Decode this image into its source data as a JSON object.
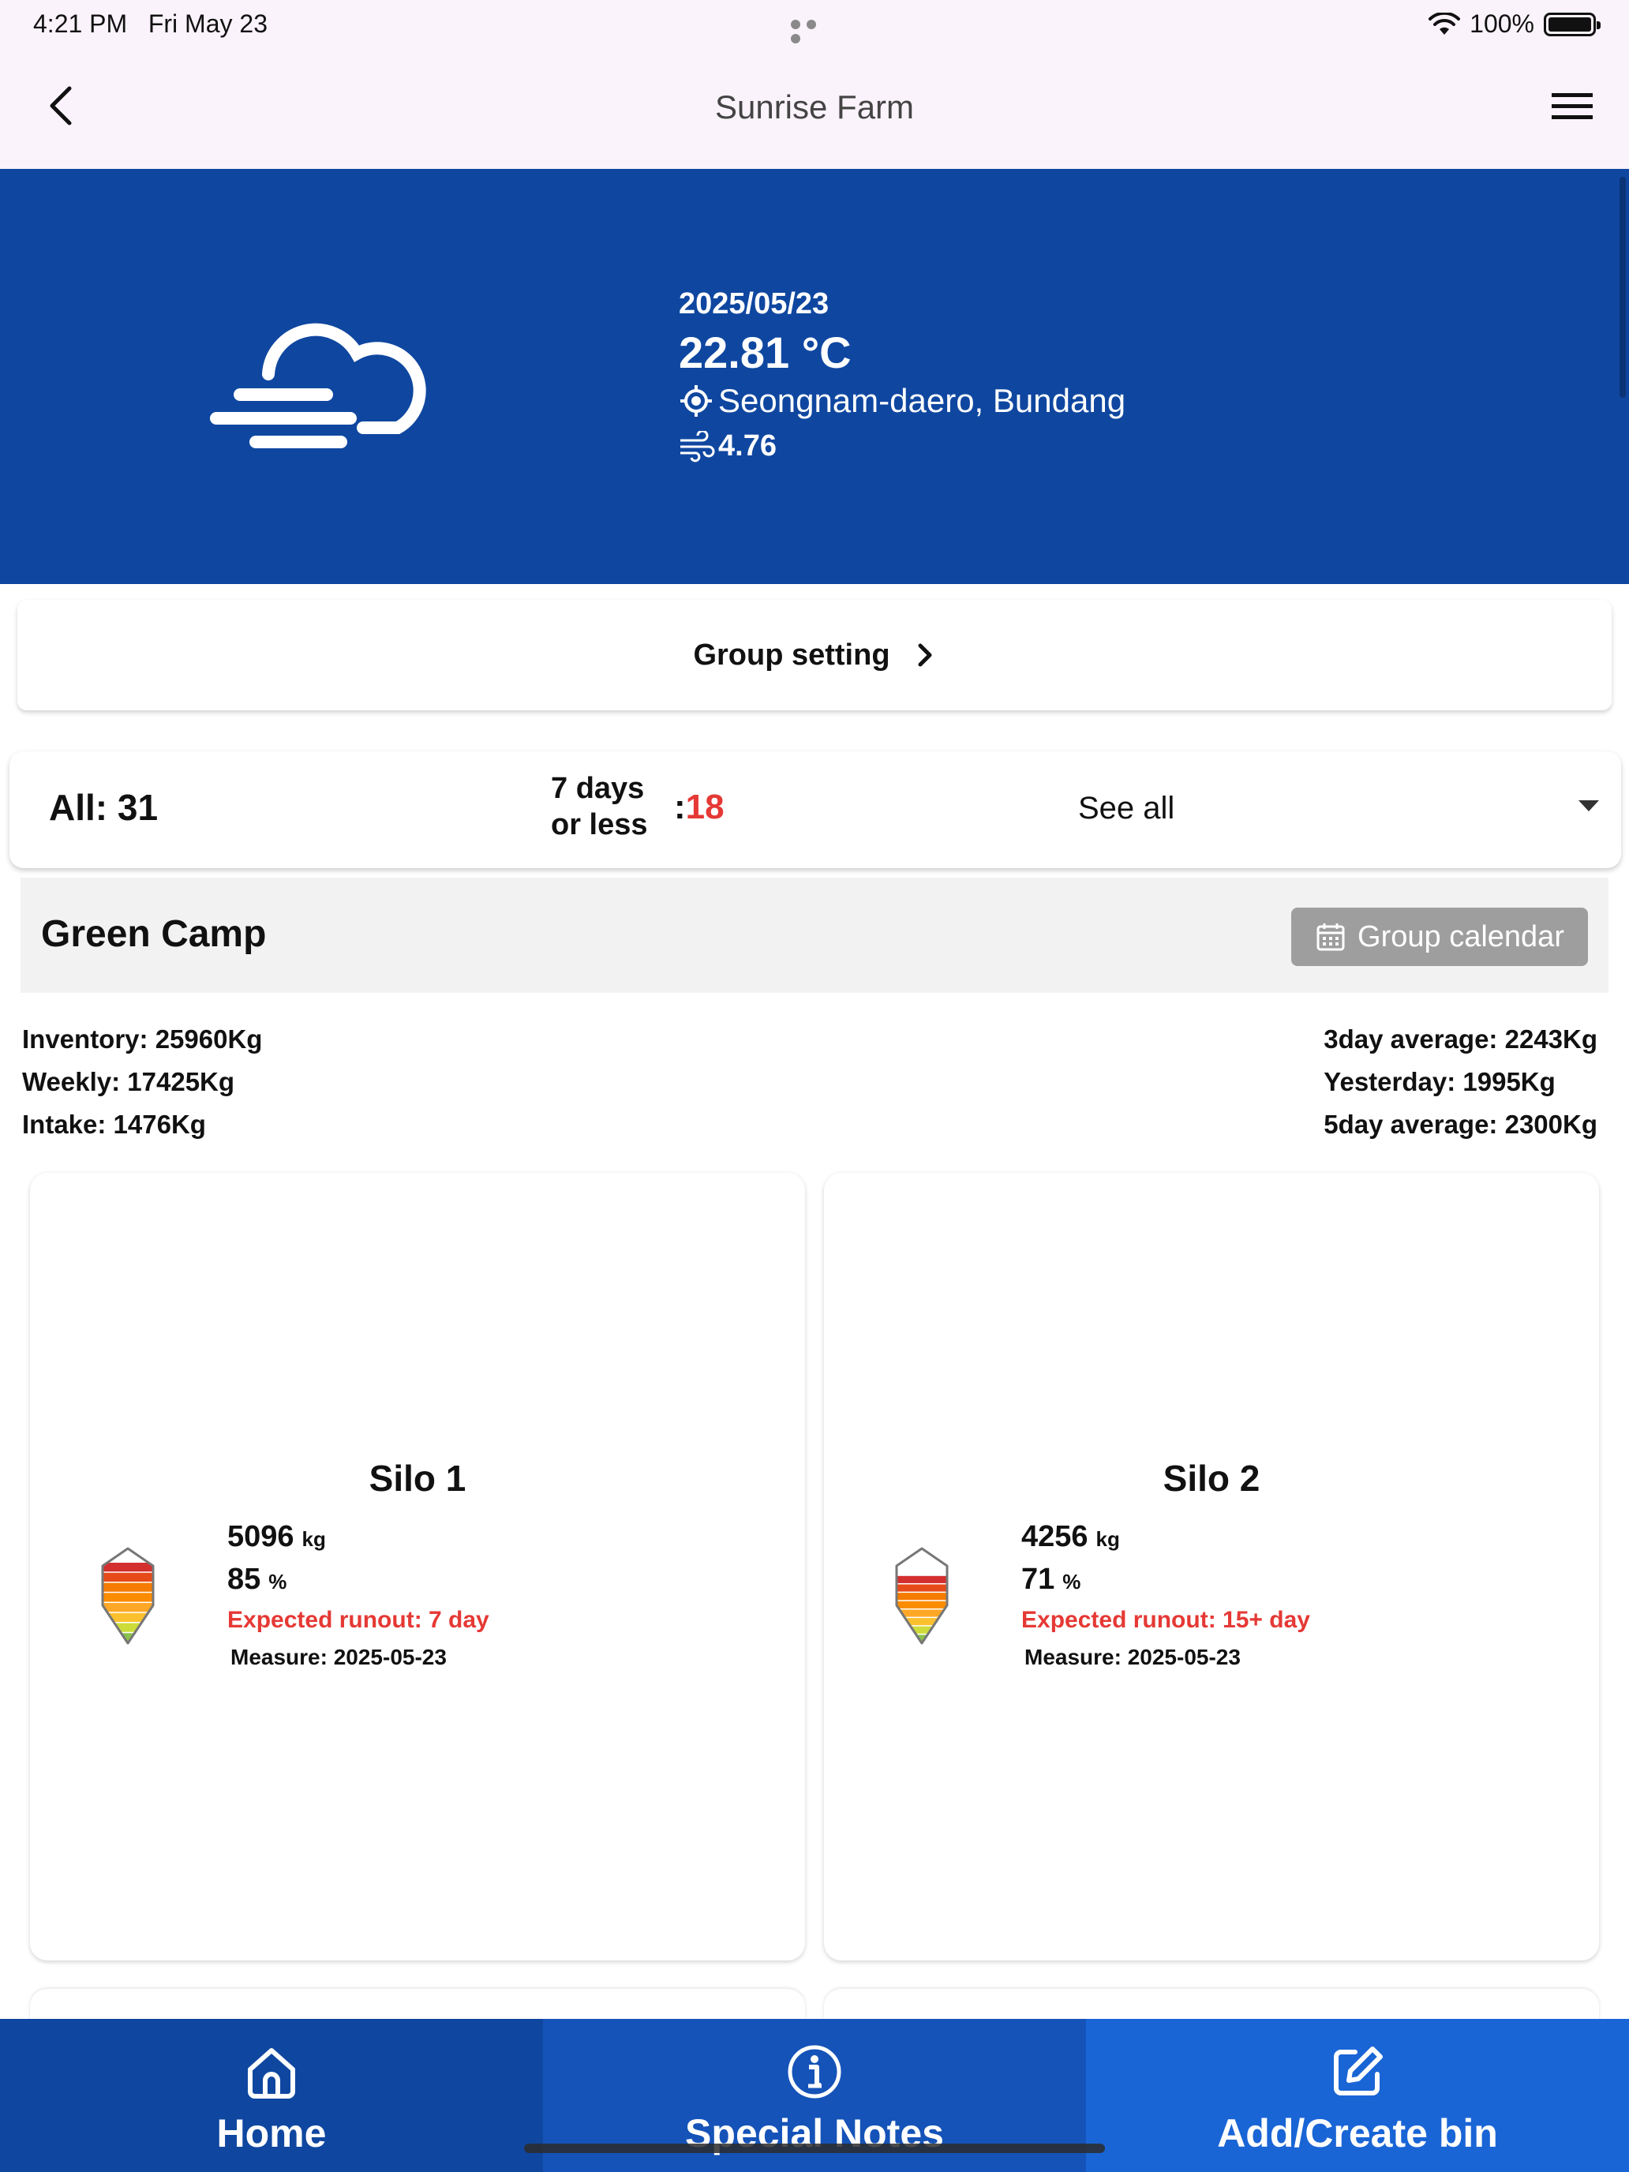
{
  "status_bar": {
    "time": "4:21 PM",
    "date": "Fri May 23",
    "battery": "100%"
  },
  "app_bar": {
    "title": "Sunrise Farm"
  },
  "weather": {
    "date": "2025/05/23",
    "temperature": "22.81 °C",
    "location": "Seongnam-daero, Bundang",
    "wind": "4.76",
    "condition_icon": "fog-cloud-icon"
  },
  "group_setting": {
    "label": "Group setting"
  },
  "filter": {
    "all_label": "All: 31",
    "days_line1": "7 days",
    "days_line2": "or less",
    "days_colon": ":",
    "days_count": "18",
    "dropdown_value": "See all"
  },
  "group": {
    "name": "Green Camp",
    "calendar_button": "Group calendar",
    "stats_left": [
      "Inventory: 25960Kg",
      "Weekly: 17425Kg",
      "Intake: 1476Kg"
    ],
    "stats_right": [
      "3day average: 2243Kg",
      "Yesterday: 1995Kg",
      "5day average: 2300Kg"
    ]
  },
  "silos": [
    {
      "title": "Silo 1",
      "kg": "5096",
      "kg_unit": "kg",
      "percent": "85",
      "percent_unit": "%",
      "fill_level": 0.85,
      "runout": "Expected runout: 7 day",
      "measure": "Measure: 2025-05-23"
    },
    {
      "title": "Silo 2",
      "kg": "4256",
      "kg_unit": "kg",
      "percent": "71",
      "percent_unit": "%",
      "fill_level": 0.71,
      "runout": "Expected runout: 15+ day",
      "measure": "Measure: 2025-05-23"
    }
  ],
  "bottom_nav": [
    {
      "label": "Home",
      "icon": "home-icon"
    },
    {
      "label": "Special Notes",
      "icon": "info-icon"
    },
    {
      "label": "Add/Create bin",
      "icon": "edit-icon"
    }
  ],
  "colors": {
    "primary": "#0f47a0",
    "alert": "#e53935"
  }
}
